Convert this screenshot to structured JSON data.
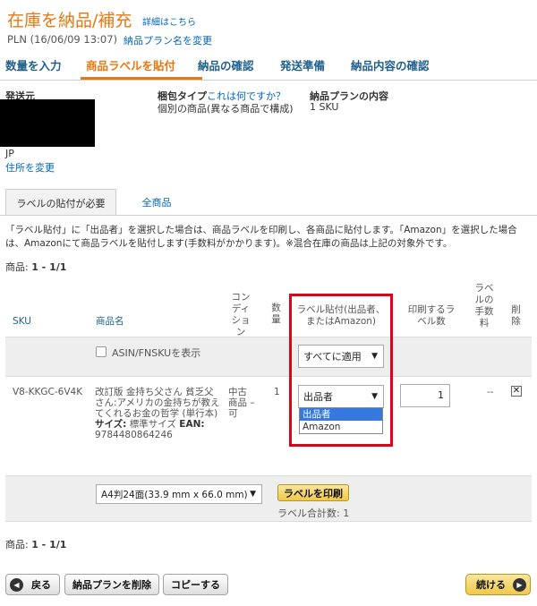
{
  "header": {
    "title": "在庫を納品/補充",
    "detail_link": "詳細はこちら",
    "plan_line": "PLN (16/06/09 13:07)",
    "rename_link": "納品プラン名を変更"
  },
  "steps": [
    {
      "label": "数量を入力"
    },
    {
      "label": "商品ラベルを貼付"
    },
    {
      "label": "納品の確認"
    },
    {
      "label": "発送準備"
    },
    {
      "label": "納品内容の確認"
    }
  ],
  "ship_from": {
    "label": "発送元",
    "country": "JP",
    "change_address": "住所を変更"
  },
  "packing": {
    "label": "梱包タイプ",
    "help_link": "これは何ですか？",
    "value": "個別の商品(異なる商品で構成)"
  },
  "plan_contents": {
    "label": "納品プランの内容",
    "value": "1 SKU"
  },
  "tabs": {
    "active": "ラベルの貼付が必要",
    "other": "全商品"
  },
  "notice": "「ラベル貼付」に「出品者」を選択した場合は、商品ラベルを印刷し、各商品に貼付します。「Amazon」を選択した場合は、Amazonにて商品ラベルを貼付します(手数料がかかります)。※混合在庫の商品は上記の対象外です。",
  "count": {
    "label": "商品: ",
    "value": "1 - 1/1"
  },
  "table": {
    "headers": {
      "sku": "SKU",
      "name": "商品名",
      "condition": "コンディション",
      "qty": "数量",
      "label_by": "ラベル貼付(出品者、またはAmazon)",
      "print_qty": "印刷するラベル数",
      "fee": "ラベルの手数料",
      "delete": "削除"
    },
    "show_asin": "ASIN/FNSKUを表示",
    "apply_all": "すべてに適用",
    "row": {
      "sku": "V8-KKGC-6V4K",
      "name": "改訂版 金持ち父さん 貧乏父さん:アメリカの金持ちが教えてくれるお金の哲学 (単行本)",
      "size_label": "サイズ:",
      "size_value": "標準サイズ",
      "ean_label": "EAN:",
      "ean": "9784480864246",
      "condition": "中古商品 – 可",
      "qty": "1",
      "label_by_selected": "出品者",
      "print_qty": "1",
      "fee": "--",
      "options": [
        "出品者",
        "Amazon"
      ]
    }
  },
  "print": {
    "paper": "A4判24面(33.9 mm x 66.0 mm)",
    "button": "ラベルを印刷",
    "total_label": "ラベル合計数: 1"
  },
  "footer": {
    "back": "戻る",
    "delete_plan": "納品プランを削除",
    "copy": "コピーする",
    "continue": "続ける"
  }
}
